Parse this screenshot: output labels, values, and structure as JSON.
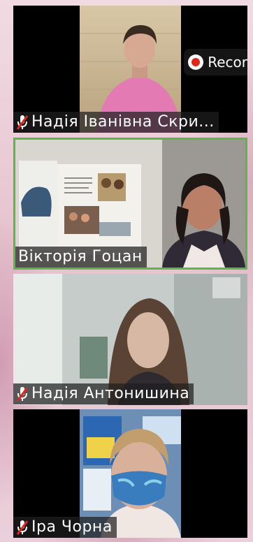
{
  "participants": [
    {
      "name": "Надія Іванівна Скри...",
      "muted": true
    },
    {
      "name": "Вікторія Гоцан",
      "muted": false,
      "active_speaker": true
    },
    {
      "name": "Надія Антонишина",
      "muted": true
    },
    {
      "name": "Іра Чорна",
      "muted": true
    }
  ],
  "recording": {
    "label": "Recor",
    "icon": "record-dot-icon"
  },
  "colors": {
    "active_speaker_border": "#58b947",
    "record_dot": "#e0261b"
  }
}
